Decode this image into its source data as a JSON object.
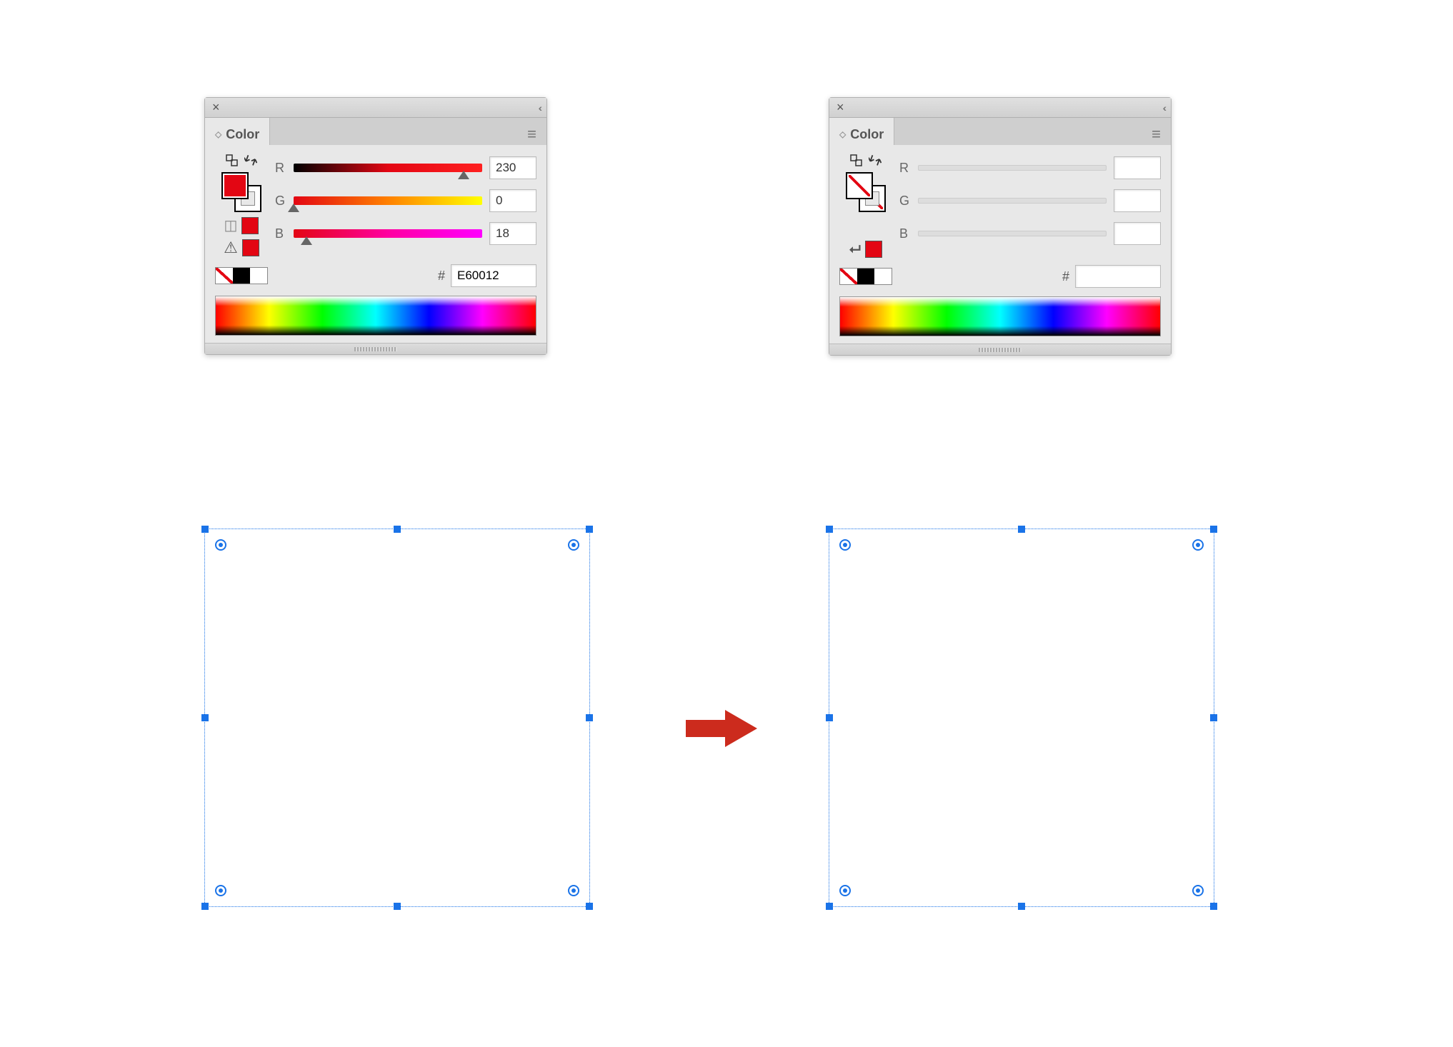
{
  "panels": {
    "left": {
      "title": "Color",
      "fill_color": "#e30613",
      "channels": {
        "r": {
          "label": "R",
          "value": "230",
          "thumb_pct": 90
        },
        "g": {
          "label": "G",
          "value": "0",
          "thumb_pct": 0
        },
        "b": {
          "label": "B",
          "value": "18",
          "thumb_pct": 7
        }
      },
      "hex_prefix": "#",
      "hex_value": "E60012",
      "has_fill": true
    },
    "right": {
      "title": "Color",
      "channels": {
        "r": {
          "label": "R",
          "value": ""
        },
        "g": {
          "label": "G",
          "value": ""
        },
        "b": {
          "label": "B",
          "value": ""
        }
      },
      "hex_prefix": "#",
      "hex_value": "",
      "has_fill": false,
      "last_color": "#e30613"
    }
  }
}
